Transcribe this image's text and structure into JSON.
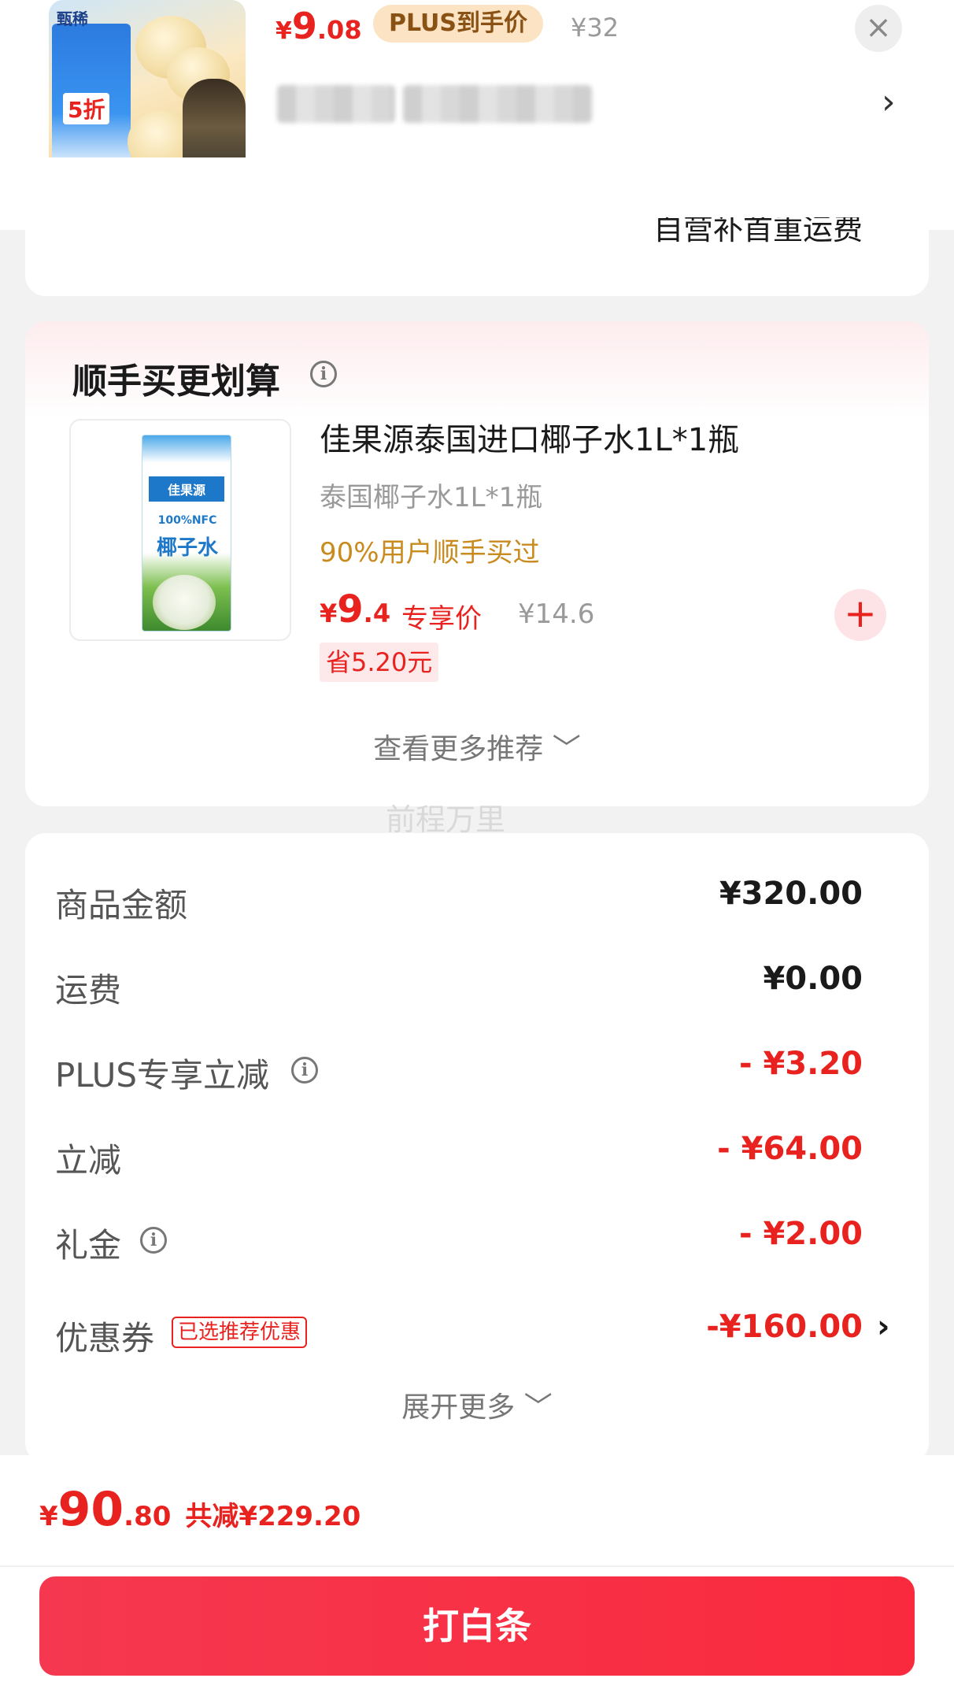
{
  "top_product": {
    "price_yen": "¥",
    "price_int": "9",
    "price_dec": ".08",
    "plus_label": "PLUS到手价",
    "original_price": "¥32",
    "thumb_brand": "甄稀",
    "thumb_discount": "5折"
  },
  "shipping": {
    "text": "自营补首重运费"
  },
  "recommend": {
    "title": "顺手买更划算",
    "product_name": "佳果源泰国进口椰子水1L*1瓶",
    "spec": "泰国椰子水1L*1瓶",
    "social_proof": "90%用户顺手买过",
    "price_yen": "¥",
    "price_int": "9",
    "price_dec": ".4",
    "price_label": "专享价",
    "original_price": "¥14.6",
    "save_text": "省5.20元",
    "see_more": "查看更多推荐 ﹀",
    "thumb_brand": "佳果源",
    "thumb_nfc": "100%NFC",
    "thumb_name": "椰子水"
  },
  "watermark": "前程万里",
  "summary": {
    "rows": [
      {
        "label": "商品金额",
        "value": "¥320.00"
      },
      {
        "label": "运费",
        "value": "¥0.00"
      },
      {
        "label": "PLUS专享立减",
        "value": "- ¥3.20"
      },
      {
        "label": "立减",
        "value": "- ¥64.00"
      },
      {
        "label": "礼金",
        "value": "- ¥2.00"
      },
      {
        "label": "优惠券",
        "value": "-¥160.00"
      }
    ],
    "coupon_tag": "已选推荐优惠",
    "expand_more": "展开更多 ﹀"
  },
  "footer": {
    "total_yen": "¥",
    "total_int": "90",
    "total_dec": ".80",
    "reduced_text": "共减¥229.20",
    "pay_button": "打白条"
  },
  "colors": {
    "accent_red": "#e8231f",
    "plus_bg": "#fbe3c3",
    "social_orange": "#c98a1e",
    "pay_button": "#f5384f"
  },
  "icons": {
    "close": "close-icon",
    "chevron_right": "chevron-right-icon",
    "info": "info-icon",
    "add": "plus-icon"
  }
}
